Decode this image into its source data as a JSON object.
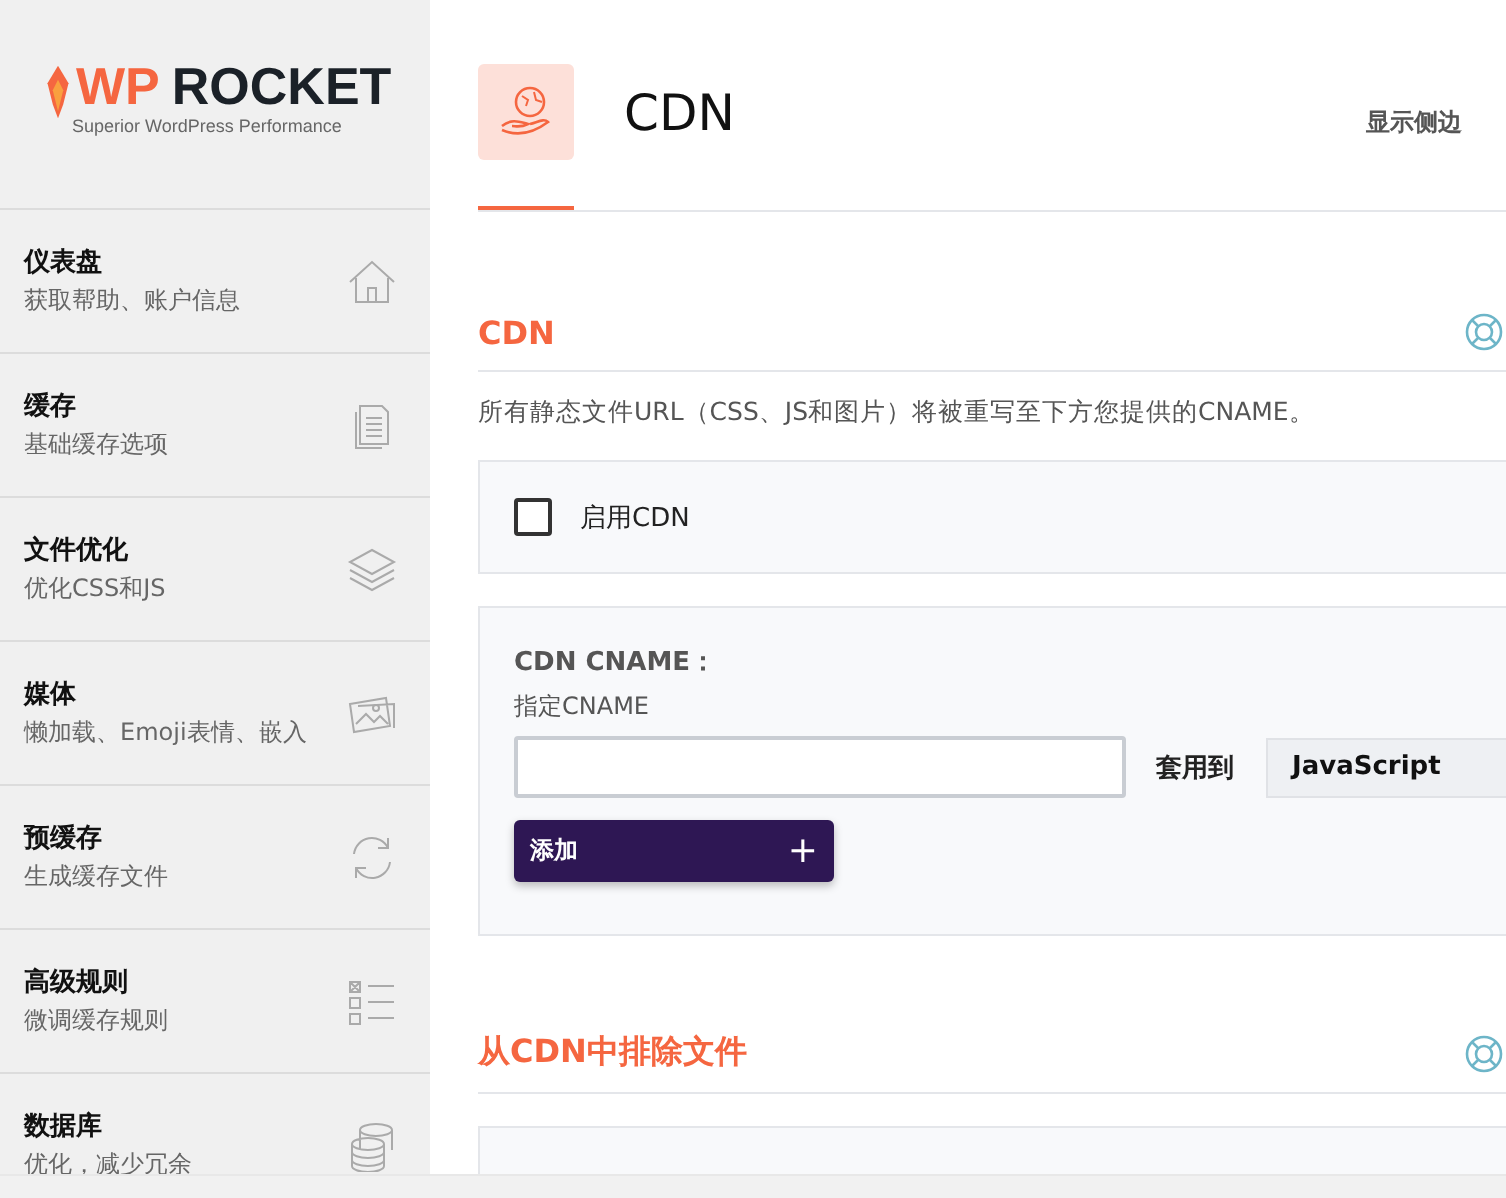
{
  "logo": {
    "name": "ROCKET",
    "mark": "WP",
    "tagline": "Superior WordPress Performance"
  },
  "sidebar": {
    "items": [
      {
        "title": "仪表盘",
        "subtitle": "获取帮助、账户信息",
        "kind": "home",
        "selected": false
      },
      {
        "title": "缓存",
        "subtitle": "基础缓存选项",
        "kind": "file",
        "selected": false
      },
      {
        "title": "文件优化",
        "subtitle": "优化CSS和JS",
        "kind": "layers",
        "selected": false
      },
      {
        "title": "媒体",
        "subtitle": "懒加载、Emoji表情、嵌入",
        "kind": "images",
        "selected": false
      },
      {
        "title": "预缓存",
        "subtitle": "生成缓存文件",
        "kind": "refresh",
        "selected": false
      },
      {
        "title": "高级规则",
        "subtitle": "微调缓存规则",
        "kind": "checklist",
        "selected": false
      },
      {
        "title": "数据库",
        "subtitle": "优化，减少冗余",
        "kind": "database",
        "selected": false
      }
    ]
  },
  "header": {
    "title": "CDN",
    "sidebar_toggle": "显示侧边"
  },
  "sections": [
    {
      "title": "CDN",
      "description": "所有静态文件URL（CSS、JS和图片）将被重写至下方您提供的CNAME。",
      "enable": {
        "label": "启用CDN",
        "checked": false
      },
      "cname": {
        "title": "CDN CNAME：",
        "hint": "指定CNAME",
        "apply_label": "套用到",
        "apply_value": "JavaScript",
        "add_button": "添加",
        "add_icon": "+"
      }
    },
    {
      "title": "从CDN中排除文件"
    }
  ]
}
